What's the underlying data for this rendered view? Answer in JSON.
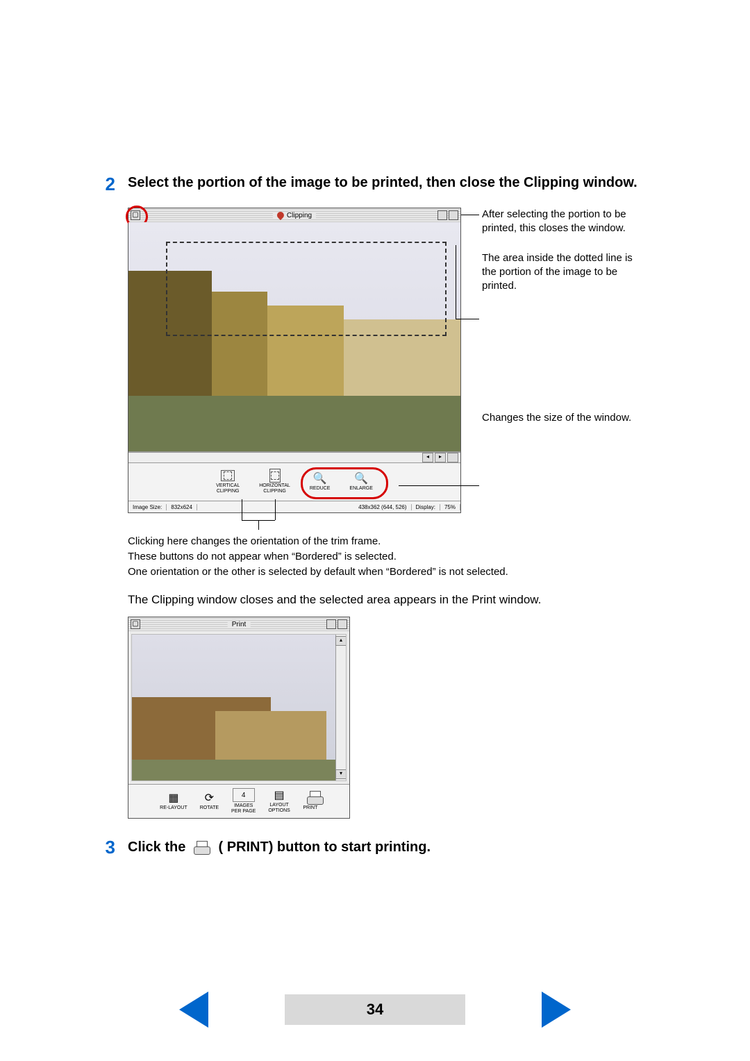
{
  "page_number": "34",
  "step2": {
    "num": "2",
    "title": "Select the portion of the image to be printed, then close the Clipping window."
  },
  "step3": {
    "num": "3",
    "text_before": "Click the ",
    "text_after": " PRINT) button to start printing.",
    "paren": "("
  },
  "clipping": {
    "title": "Clipping",
    "tool_vertical": "VERTICAL\nCLIPPING",
    "tool_horizontal": "HORIZONTAL\nCLIPPING",
    "tool_reduce": "REDUCE",
    "tool_enlarge": "ENLARGE",
    "status_label": "Image Size:",
    "status_size": "832x624",
    "status_crop": "438x362 (644, 526)",
    "status_disp_label": "Display:",
    "status_disp_val": "75%"
  },
  "callouts": {
    "close": "After selecting the portion to be printed, this closes the window.",
    "dotted": "The area inside the dotted line is the portion of the image to be printed.",
    "zoom": "Changes the size of the window."
  },
  "orientation_note": {
    "l1": "Clicking here changes the orientation of the trim frame.",
    "l2": "These buttons do not appear when “Bordered” is selected.",
    "l3": "One orientation or the other is selected by default when “Bordered” is not selected."
  },
  "closing_text": "The Clipping window closes and the selected area appears in the Print window.",
  "print": {
    "title": "Print",
    "b_relayout": "RE-LAYOUT",
    "b_rotate": "ROTATE",
    "b_images": "IMAGES\nPER PAGE",
    "b_layout": "LAYOUT\nOPTIONS",
    "b_print": "PRINT",
    "stepper": "4"
  }
}
